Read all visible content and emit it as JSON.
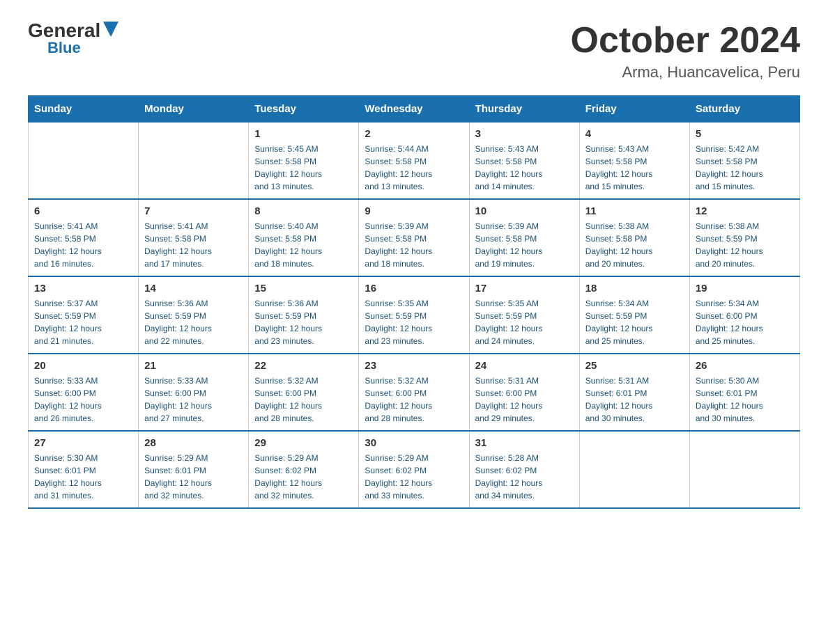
{
  "logo": {
    "general": "General",
    "blue": "Blue"
  },
  "title": {
    "month": "October 2024",
    "location": "Arma, Huancavelica, Peru"
  },
  "headers": [
    "Sunday",
    "Monday",
    "Tuesday",
    "Wednesday",
    "Thursday",
    "Friday",
    "Saturday"
  ],
  "weeks": [
    [
      {
        "day": "",
        "info": ""
      },
      {
        "day": "",
        "info": ""
      },
      {
        "day": "1",
        "info": "Sunrise: 5:45 AM\nSunset: 5:58 PM\nDaylight: 12 hours\nand 13 minutes."
      },
      {
        "day": "2",
        "info": "Sunrise: 5:44 AM\nSunset: 5:58 PM\nDaylight: 12 hours\nand 13 minutes."
      },
      {
        "day": "3",
        "info": "Sunrise: 5:43 AM\nSunset: 5:58 PM\nDaylight: 12 hours\nand 14 minutes."
      },
      {
        "day": "4",
        "info": "Sunrise: 5:43 AM\nSunset: 5:58 PM\nDaylight: 12 hours\nand 15 minutes."
      },
      {
        "day": "5",
        "info": "Sunrise: 5:42 AM\nSunset: 5:58 PM\nDaylight: 12 hours\nand 15 minutes."
      }
    ],
    [
      {
        "day": "6",
        "info": "Sunrise: 5:41 AM\nSunset: 5:58 PM\nDaylight: 12 hours\nand 16 minutes."
      },
      {
        "day": "7",
        "info": "Sunrise: 5:41 AM\nSunset: 5:58 PM\nDaylight: 12 hours\nand 17 minutes."
      },
      {
        "day": "8",
        "info": "Sunrise: 5:40 AM\nSunset: 5:58 PM\nDaylight: 12 hours\nand 18 minutes."
      },
      {
        "day": "9",
        "info": "Sunrise: 5:39 AM\nSunset: 5:58 PM\nDaylight: 12 hours\nand 18 minutes."
      },
      {
        "day": "10",
        "info": "Sunrise: 5:39 AM\nSunset: 5:58 PM\nDaylight: 12 hours\nand 19 minutes."
      },
      {
        "day": "11",
        "info": "Sunrise: 5:38 AM\nSunset: 5:58 PM\nDaylight: 12 hours\nand 20 minutes."
      },
      {
        "day": "12",
        "info": "Sunrise: 5:38 AM\nSunset: 5:59 PM\nDaylight: 12 hours\nand 20 minutes."
      }
    ],
    [
      {
        "day": "13",
        "info": "Sunrise: 5:37 AM\nSunset: 5:59 PM\nDaylight: 12 hours\nand 21 minutes."
      },
      {
        "day": "14",
        "info": "Sunrise: 5:36 AM\nSunset: 5:59 PM\nDaylight: 12 hours\nand 22 minutes."
      },
      {
        "day": "15",
        "info": "Sunrise: 5:36 AM\nSunset: 5:59 PM\nDaylight: 12 hours\nand 23 minutes."
      },
      {
        "day": "16",
        "info": "Sunrise: 5:35 AM\nSunset: 5:59 PM\nDaylight: 12 hours\nand 23 minutes."
      },
      {
        "day": "17",
        "info": "Sunrise: 5:35 AM\nSunset: 5:59 PM\nDaylight: 12 hours\nand 24 minutes."
      },
      {
        "day": "18",
        "info": "Sunrise: 5:34 AM\nSunset: 5:59 PM\nDaylight: 12 hours\nand 25 minutes."
      },
      {
        "day": "19",
        "info": "Sunrise: 5:34 AM\nSunset: 6:00 PM\nDaylight: 12 hours\nand 25 minutes."
      }
    ],
    [
      {
        "day": "20",
        "info": "Sunrise: 5:33 AM\nSunset: 6:00 PM\nDaylight: 12 hours\nand 26 minutes."
      },
      {
        "day": "21",
        "info": "Sunrise: 5:33 AM\nSunset: 6:00 PM\nDaylight: 12 hours\nand 27 minutes."
      },
      {
        "day": "22",
        "info": "Sunrise: 5:32 AM\nSunset: 6:00 PM\nDaylight: 12 hours\nand 28 minutes."
      },
      {
        "day": "23",
        "info": "Sunrise: 5:32 AM\nSunset: 6:00 PM\nDaylight: 12 hours\nand 28 minutes."
      },
      {
        "day": "24",
        "info": "Sunrise: 5:31 AM\nSunset: 6:00 PM\nDaylight: 12 hours\nand 29 minutes."
      },
      {
        "day": "25",
        "info": "Sunrise: 5:31 AM\nSunset: 6:01 PM\nDaylight: 12 hours\nand 30 minutes."
      },
      {
        "day": "26",
        "info": "Sunrise: 5:30 AM\nSunset: 6:01 PM\nDaylight: 12 hours\nand 30 minutes."
      }
    ],
    [
      {
        "day": "27",
        "info": "Sunrise: 5:30 AM\nSunset: 6:01 PM\nDaylight: 12 hours\nand 31 minutes."
      },
      {
        "day": "28",
        "info": "Sunrise: 5:29 AM\nSunset: 6:01 PM\nDaylight: 12 hours\nand 32 minutes."
      },
      {
        "day": "29",
        "info": "Sunrise: 5:29 AM\nSunset: 6:02 PM\nDaylight: 12 hours\nand 32 minutes."
      },
      {
        "day": "30",
        "info": "Sunrise: 5:29 AM\nSunset: 6:02 PM\nDaylight: 12 hours\nand 33 minutes."
      },
      {
        "day": "31",
        "info": "Sunrise: 5:28 AM\nSunset: 6:02 PM\nDaylight: 12 hours\nand 34 minutes."
      },
      {
        "day": "",
        "info": ""
      },
      {
        "day": "",
        "info": ""
      }
    ]
  ]
}
